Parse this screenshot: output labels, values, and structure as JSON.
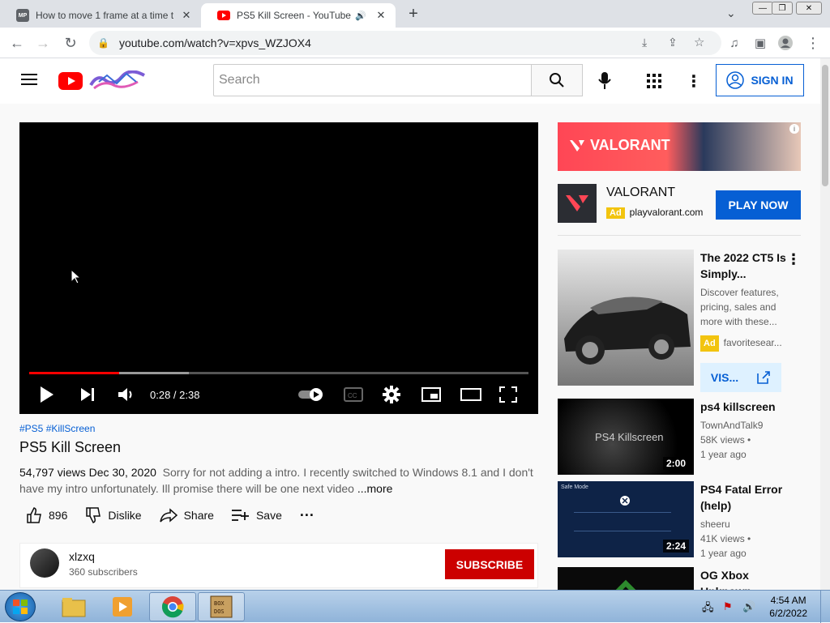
{
  "tabs": [
    {
      "title": "How to move 1 frame at a time t",
      "favicon": "MP"
    },
    {
      "title": "PS5 Kill Screen - YouTube",
      "active": true
    }
  ],
  "address": {
    "url": "youtube.com/watch?v=xpvs_WZJOX4"
  },
  "header": {
    "search_placeholder": "Search",
    "signin_label": "SIGN IN"
  },
  "player": {
    "time": "0:28 / 2:38",
    "played_fraction": 0.18,
    "buffered_fraction": 0.32
  },
  "video": {
    "tags": "#PS5 #KillScreen",
    "title": "PS5 Kill Screen",
    "stats": "54,797 views  Dec 30, 2020",
    "description": "Sorry for not adding a intro. I recently switched to Windows 8.1 and I don't have my intro unfortunately. Ill promise there will be one next video",
    "more_label": "...more"
  },
  "actions": {
    "likes": "896",
    "dislike": "Dislike",
    "share": "Share",
    "save": "Save"
  },
  "channel": {
    "name": "xlzxq",
    "subscribers": "360 subscribers",
    "subscribe_label": "SUBSCRIBE"
  },
  "ad": {
    "banner_text": "VALORANT",
    "name": "VALORANT",
    "badge": "Ad",
    "domain": "playvalorant.com",
    "cta": "PLAY NOW"
  },
  "recommendations": [
    {
      "title": "The 2022 CT5 Is Simply...",
      "desc": "Discover features, pricing, sales and more with these...",
      "badge": "Ad",
      "source": "favoritesear...",
      "cta": "VIS..."
    },
    {
      "title": "ps4 killscreen",
      "channel": "TownAndTalk9",
      "views": "58K views •",
      "age": "1 year ago",
      "duration": "2:00",
      "thumb_text": "PS4 Killscreen"
    },
    {
      "title": "PS4 Fatal Error (help)",
      "channel": "sheeru",
      "views": "41K views •",
      "age": "1 year ago",
      "duration": "2:24",
      "thumb_text": "Safe Mode"
    },
    {
      "title": "OG Xbox Unknown"
    }
  ],
  "taskbar": {
    "time": "4:54 AM",
    "date": "6/2/2022"
  },
  "colors": {
    "youtube_red": "#ff0000",
    "accent_blue": "#065fd4",
    "subscribe_red": "#cc0000",
    "ad_yellow": "#f2c40f"
  }
}
